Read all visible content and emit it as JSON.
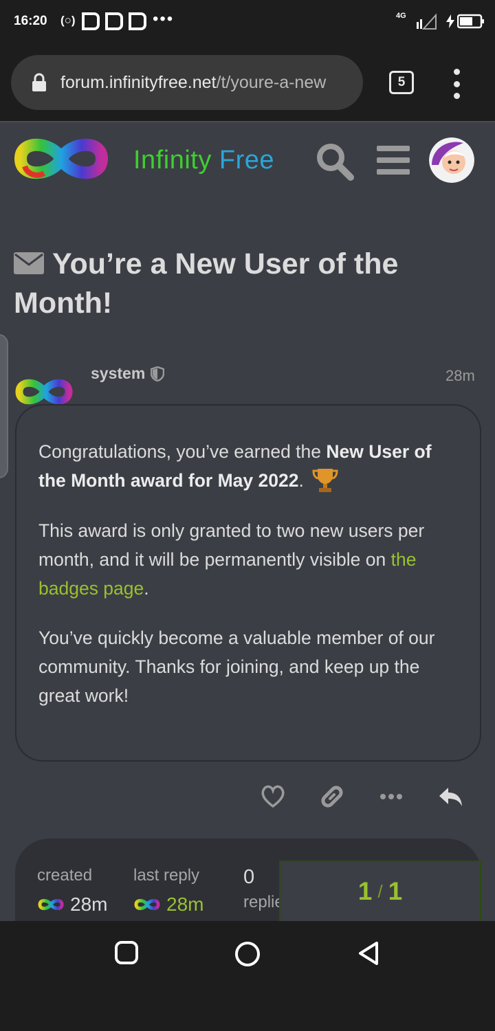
{
  "status_bar": {
    "time": "16:20",
    "network": "4G",
    "icons": [
      "radio-icon",
      "app-icon",
      "app-icon",
      "app-icon",
      "more-dots-icon",
      "signal-icon",
      "battery-charging-icon"
    ]
  },
  "browser": {
    "url_host": "forum.infinityfree.net",
    "url_path": "/t/youre-a-new",
    "tab_count": "5",
    "icons": [
      "lock-icon",
      "more-vert-icon"
    ]
  },
  "header": {
    "logo_text_a": "Infinity",
    "logo_text_b": "Free",
    "icons": [
      "infinity-logo-icon",
      "search-icon",
      "hamburger-icon",
      "user-avatar"
    ]
  },
  "topic": {
    "title": "You’re a New User of the Month!",
    "title_icon": "envelope-icon"
  },
  "post": {
    "author": "system",
    "time": "28m",
    "p1_pre": "Congratulations, you’ve earned the ",
    "p1_bold": "New User of the Month award for May 2022",
    "p1_post": ".",
    "p2_pre": "This award is only granted to two new users per month, and it will be permanently visible on ",
    "p2_link": "the badges page",
    "p2_post": ".",
    "p3": "You’ve quickly become a valuable member of our community. Thanks for joining, and keep up the great work!",
    "actions": [
      "heart-icon",
      "link-icon",
      "more-horiz-icon",
      "reply-icon"
    ]
  },
  "topic_map": {
    "created_label": "created",
    "created_value": "28m",
    "last_reply_label": "last reply",
    "last_reply_value": "28m",
    "replies_count": "0",
    "replies_label": "replies"
  },
  "progress": {
    "current": "1",
    "sep": "/",
    "total": "1"
  },
  "colors": {
    "accent_green": "#9ac12e",
    "logo_green": "#3ecf2f",
    "logo_blue": "#2aa6d8",
    "background": "#3b3e45"
  }
}
